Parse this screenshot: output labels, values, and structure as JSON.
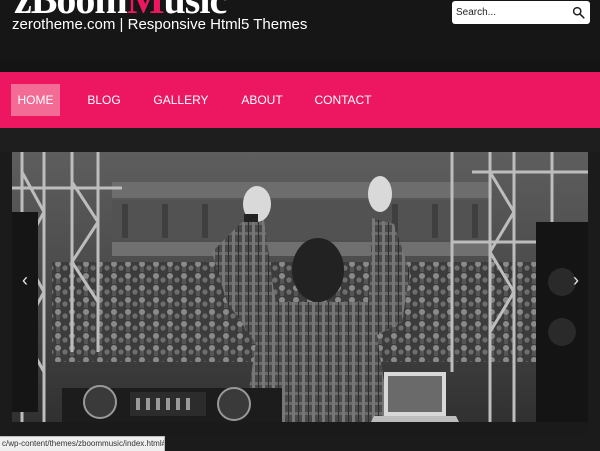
{
  "site": {
    "logo_main": "zBoom",
    "logo_accent": "M",
    "logo_rest": "usic",
    "tagline": "zerotheme.com | Responsive Html5 Themes"
  },
  "search": {
    "placeholder": "Search..."
  },
  "nav": {
    "items": [
      {
        "label": "HOME",
        "active": true
      },
      {
        "label": "BLOG",
        "active": false
      },
      {
        "label": "GALLERY",
        "active": false
      },
      {
        "label": "ABOUT",
        "active": false
      },
      {
        "label": "CONTACT",
        "active": false
      }
    ]
  },
  "slider": {
    "prev_glyph": "‹",
    "next_glyph": "›",
    "image_description": "DJ with raised arms in front of a cheering crowd"
  },
  "status_bar": {
    "url": "c/wp-content/themes/zboommusic/index.html#"
  },
  "colors": {
    "accent": "#ec1760",
    "active_nav": "#f36c96",
    "background": "#1b1b1b"
  },
  "icons": {
    "search": "magnifier-icon",
    "prev": "chevron-left-icon",
    "next": "chevron-right-icon"
  }
}
